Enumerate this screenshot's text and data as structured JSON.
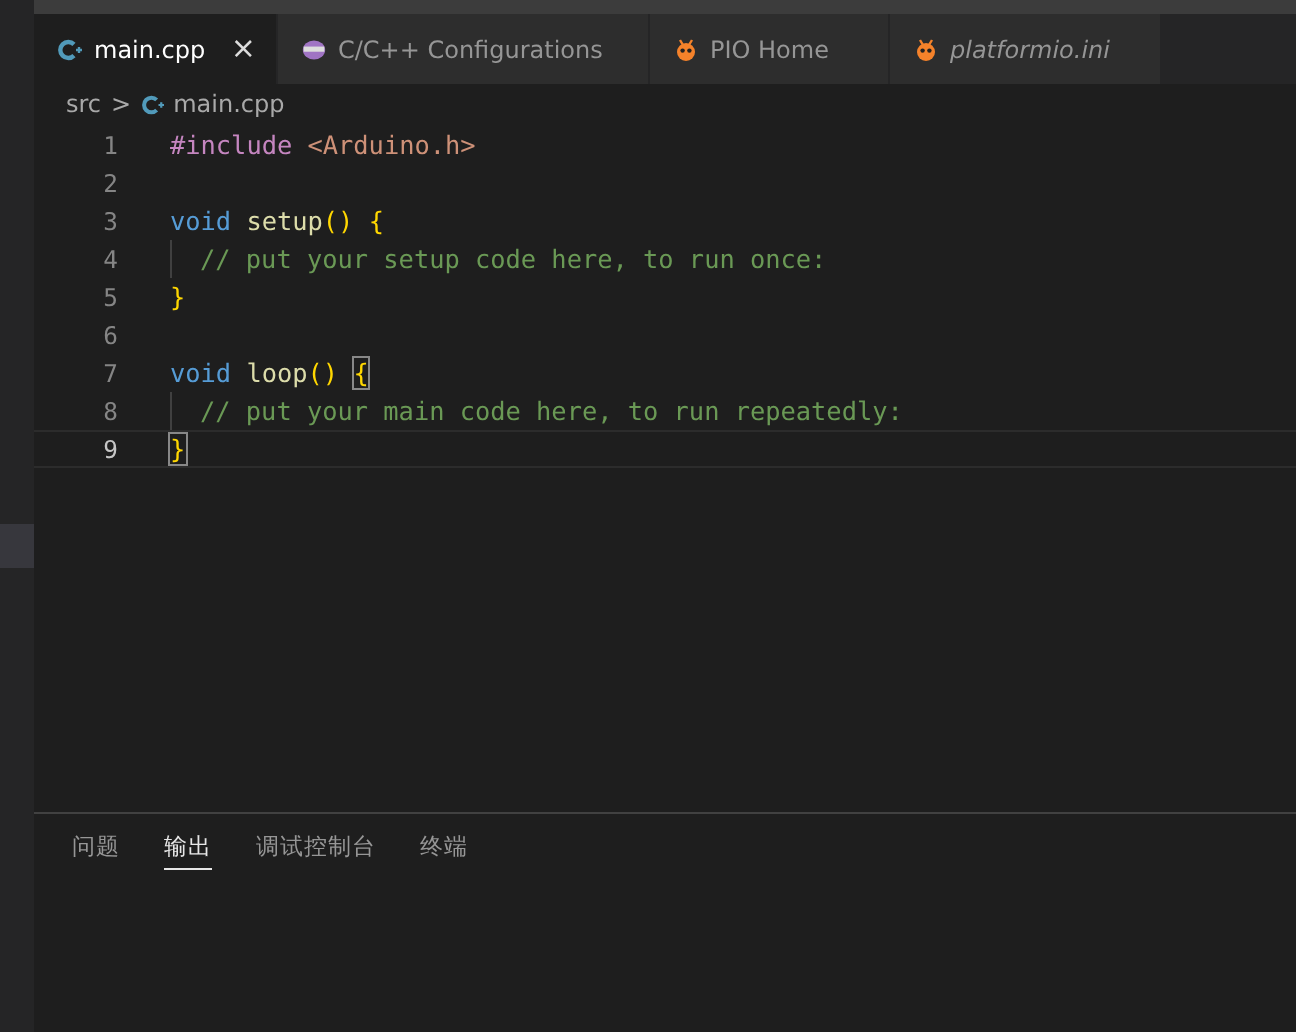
{
  "tabs": [
    {
      "label": "main.cpp",
      "kind": "cpp",
      "selected": true,
      "preview": false,
      "close": "×"
    },
    {
      "label": "C/C++ Configurations",
      "kind": "config",
      "selected": false,
      "preview": false
    },
    {
      "label": "PIO Home",
      "kind": "platformio",
      "selected": false,
      "preview": false
    },
    {
      "label": "platformio.ini",
      "kind": "platformio",
      "selected": false,
      "preview": true
    }
  ],
  "breadcrumb": {
    "folder": "src",
    "separator": ">",
    "file": "main.cpp"
  },
  "editor": {
    "lines": [
      {
        "number": "1",
        "current": false,
        "guide": false,
        "tokens": [
          {
            "kind": "preproc",
            "text": "#include"
          },
          {
            "kind": "string",
            "text": " <Arduino.h>"
          }
        ]
      },
      {
        "number": "2",
        "current": false,
        "guide": false
      },
      {
        "number": "3",
        "current": false,
        "guide": false,
        "tokens": [
          {
            "kind": "keyword",
            "text": "void"
          },
          {
            "kind": "function",
            "text": " setup"
          },
          {
            "kind": "bracket",
            "text": "()"
          },
          {
            "kind": "bracket",
            "text": " {"
          }
        ]
      },
      {
        "number": "4",
        "current": false,
        "guide": true,
        "tokens": [
          {
            "kind": "comment",
            "text": "// put your setup code here, to run once:"
          }
        ]
      },
      {
        "number": "5",
        "current": false,
        "guide": false,
        "tokens": [
          {
            "kind": "bracket",
            "text": "}"
          }
        ]
      },
      {
        "number": "6",
        "current": false,
        "guide": false
      },
      {
        "number": "7",
        "current": false,
        "guide": false,
        "tokens": [
          {
            "kind": "keyword",
            "text": "void"
          },
          {
            "kind": "function",
            "text": " loop"
          },
          {
            "kind": "bracket",
            "text": "() "
          },
          {
            "kind": "bracket",
            "text": "{",
            "matched": true
          }
        ]
      },
      {
        "number": "8",
        "current": false,
        "guide": true,
        "tokens": [
          {
            "kind": "comment",
            "text": "// put your main code here, to run repeatedly:"
          }
        ]
      },
      {
        "number": "9",
        "current": true,
        "guide": false,
        "tokens": [
          {
            "kind": "bracket",
            "text": "}",
            "matched": true
          }
        ]
      }
    ]
  },
  "panel": {
    "tabs": [
      {
        "label": "问题",
        "selected": false
      },
      {
        "label": "输出",
        "selected": true
      },
      {
        "label": "调试控制台",
        "selected": false
      },
      {
        "label": "终端",
        "selected": false
      }
    ]
  }
}
